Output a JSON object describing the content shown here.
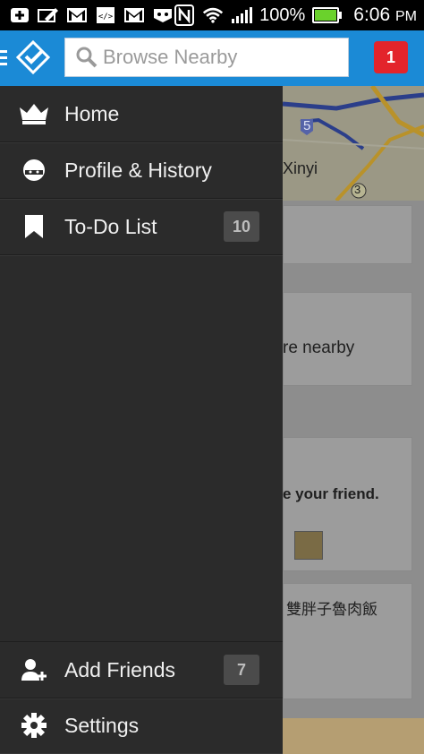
{
  "status_bar": {
    "battery_text": "100%",
    "time": "6:06",
    "ampm": "PM",
    "battery_level": 1.0,
    "icons": [
      "plus-icon",
      "pencil-icon",
      "gmail-icon",
      "code-icon",
      "gmail-icon",
      "fox-icon",
      "nfc-icon",
      "wifi-icon",
      "signal-icon"
    ]
  },
  "app_bar": {
    "search_placeholder": "Browse Nearby",
    "notification_count": "1",
    "colors": {
      "bar": "#1b8ad6",
      "badge": "#e3242b"
    }
  },
  "drawer": {
    "items": [
      {
        "label": "Home",
        "icon": "crown-icon"
      },
      {
        "label": "Profile & History",
        "icon": "profile-icon"
      },
      {
        "label": "To-Do List",
        "icon": "bookmark-icon",
        "badge": "10"
      }
    ],
    "bottom_items": [
      {
        "label": "Add Friends",
        "icon": "add-person-icon",
        "badge": "7"
      },
      {
        "label": "Settings",
        "icon": "gear-icon"
      }
    ]
  },
  "background": {
    "map_label": "Xinyi",
    "route_5": "5",
    "route_3": "3",
    "snippet_1": "re nearby",
    "snippet_2": "e your friend.",
    "snippet_3": "雙胖子魯肉飯"
  }
}
